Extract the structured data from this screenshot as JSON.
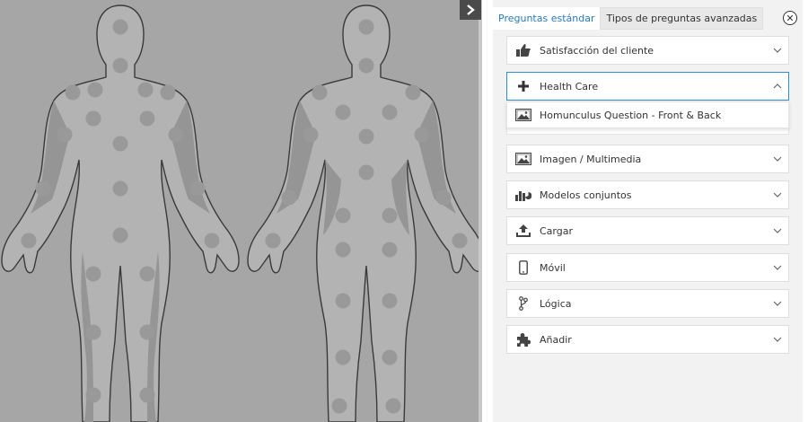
{
  "canvas": {
    "background_color": "#a6a6a6",
    "body_color": "#b3b3b3",
    "shade_color": "#959595",
    "dot_color": "#999999",
    "outline_color": "#3a3a3a",
    "collapse_icon": "chevron-right-icon"
  },
  "tabs": {
    "standard": "Preguntas estándar",
    "advanced": "Tipos de preguntas avanzadas"
  },
  "close_icon": "close-circle-icon",
  "accordion": [
    {
      "label": "Satisfacción del cliente",
      "icon": "thumbs-up-icon",
      "state": "collapsed"
    },
    {
      "label": "Health Care",
      "icon": "plus-icon",
      "state": "expanded"
    },
    {
      "label": "Imagen / Multimedia",
      "icon": "image-icon",
      "state": "collapsed"
    },
    {
      "label": "Modelos conjuntos",
      "icon": "bar-pie-chart-icon",
      "state": "collapsed"
    },
    {
      "label": "Cargar",
      "icon": "upload-icon",
      "state": "collapsed"
    },
    {
      "label": "Móvil",
      "icon": "mobile-icon",
      "state": "collapsed"
    },
    {
      "label": "Lógica",
      "icon": "branch-icon",
      "state": "collapsed"
    },
    {
      "label": "Añadir",
      "icon": "puzzle-icon",
      "state": "collapsed"
    }
  ],
  "dropdown": {
    "item_label": "Homunculus Question - Front & Back",
    "icon": "image-icon"
  },
  "colors": {
    "accent": "#2f8ed0",
    "tab_link": "#2a7ab8",
    "panel_bg": "#f2f2f2"
  }
}
